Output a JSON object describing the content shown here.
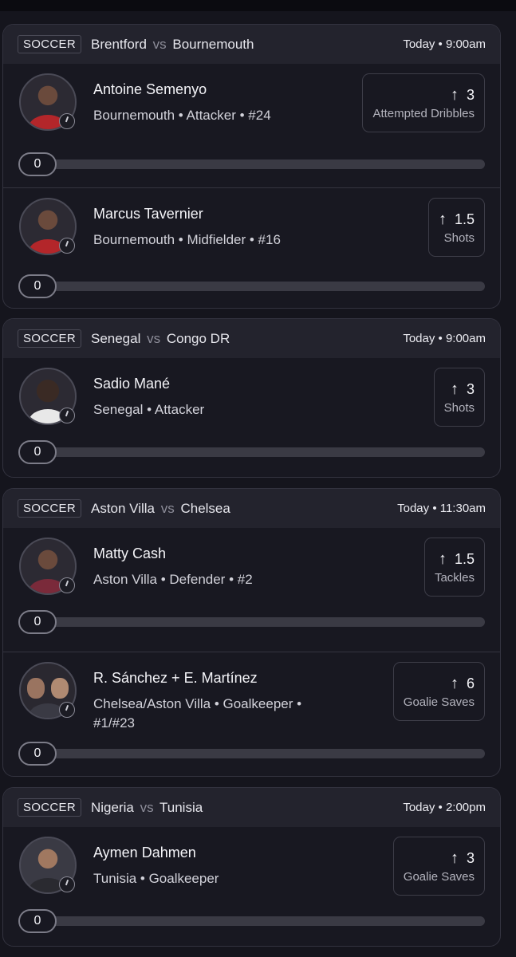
{
  "games": [
    {
      "sport": "SOCCER",
      "home": "Brentford",
      "vs": "vs",
      "away": "Bournemouth",
      "time": "Today • 9:00am",
      "players": [
        {
          "name": "Antoine Semenyo",
          "meta": "Bournemouth • Attacker • #24",
          "direction": "up",
          "line": "3",
          "stat": "Attempted Dribbles",
          "progress": "0",
          "kit": "#b3262a"
        },
        {
          "name": "Marcus Tavernier",
          "meta": "Bournemouth • Midfielder • #16",
          "direction": "up",
          "line": "1.5",
          "stat": "Shots",
          "progress": "0",
          "kit": "#b3262a"
        }
      ]
    },
    {
      "sport": "SOCCER",
      "home": "Senegal",
      "vs": "vs",
      "away": "Congo DR",
      "time": "Today • 9:00am",
      "players": [
        {
          "name": "Sadio Mané",
          "meta": "Senegal • Attacker",
          "direction": "up",
          "line": "3",
          "stat": "Shots",
          "progress": "0",
          "kit": "#e8e8e8"
        }
      ]
    },
    {
      "sport": "SOCCER",
      "home": "Aston Villa",
      "vs": "vs",
      "away": "Chelsea",
      "time": "Today • 11:30am",
      "players": [
        {
          "name": "Matty Cash",
          "meta": "Aston Villa • Defender • #2",
          "direction": "up",
          "line": "1.5",
          "stat": "Tackles",
          "progress": "0",
          "kit": "#7a2a3a"
        },
        {
          "name": "R. Sánchez + E. Martínez",
          "meta": "Chelsea/Aston Villa • Goalkeeper • #1/#23",
          "direction": "up",
          "line": "6",
          "stat": "Goalie Saves",
          "progress": "0",
          "kit": "#3a3a44"
        }
      ]
    },
    {
      "sport": "SOCCER",
      "home": "Nigeria",
      "vs": "vs",
      "away": "Tunisia",
      "time": "Today • 2:00pm",
      "players": [
        {
          "name": "Aymen Dahmen",
          "meta": "Tunisia • Goalkeeper",
          "direction": "up",
          "line": "3",
          "stat": "Goalie Saves",
          "progress": "0",
          "kit": "#2a2a30"
        }
      ]
    }
  ]
}
